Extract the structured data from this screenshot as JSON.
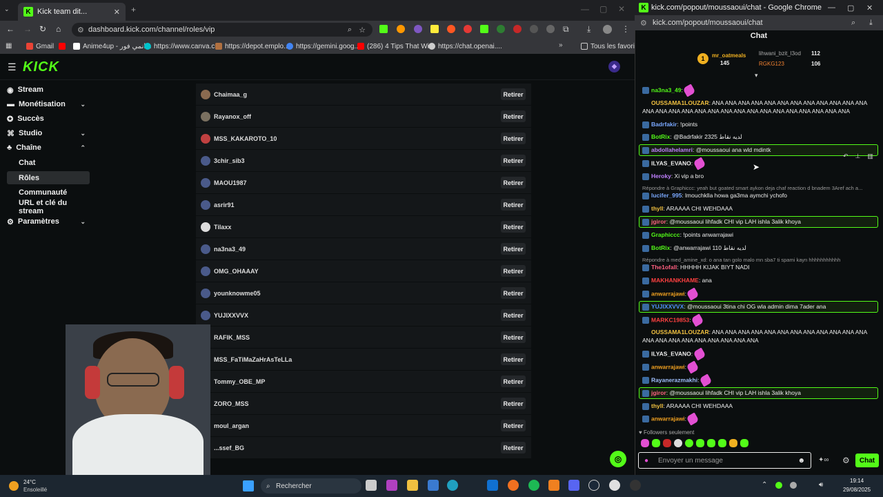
{
  "main_browser": {
    "tab_title": "Kick team dit...",
    "url": "dashboard.kick.com/channel/roles/vip",
    "bookmarks": [
      "Gmail",
      "Anime4up - انمي فور...",
      "https://www.canva.c...",
      "https://depot.emplo...",
      "https://gemini.goog...",
      "(286) 4 Tips That Wi...",
      "https://chat.openai...."
    ],
    "all_bookmarks": "Tous les favoris"
  },
  "dashboard": {
    "logo": "KICK",
    "sidebar": [
      {
        "label": "Stream",
        "icon": "broadcast-icon"
      },
      {
        "label": "Monétisation",
        "icon": "money-icon"
      },
      {
        "label": "Succès",
        "icon": "trophy-icon"
      },
      {
        "label": "Studio",
        "icon": "studio-icon"
      },
      {
        "label": "Chaîne",
        "icon": "channel-icon"
      },
      {
        "label": "Chat"
      },
      {
        "label": "Rôles"
      },
      {
        "label": "Communauté"
      },
      {
        "label": "URL et clé du stream"
      },
      {
        "label": "Paramètres",
        "icon": "gear-icon"
      }
    ],
    "remove_label": "Retirer",
    "vips": [
      "Chaimaa_g",
      "Rayanox_off",
      "MSS_KAKAROTO_10",
      "3chir_sib3",
      "MAOU1987",
      "asrir91",
      "Tilaxx",
      "na3na3_49",
      "OMG_OHAAAY",
      "younknowme05",
      "YUJIXXVVX",
      "RAFIK_MSS",
      "MSS_FaTiMaZaHrAsTeLLa",
      "Tommy_OBE_MP",
      "ZORO_MSS",
      "moul_argan",
      "...ssef_BG"
    ]
  },
  "chat_window": {
    "title": "kick.com/popout/moussaoui/chat - Google Chrome",
    "url": "kick.com/popout/moussaoui/chat",
    "header": "Chat",
    "leaderboard": [
      {
        "rank": "1",
        "name": "mr_oatmeals",
        "count": "145"
      },
      {
        "name": "lihwani_bzit_l3od",
        "count": "112"
      },
      {
        "name": "RGKG123",
        "count": "106"
      }
    ],
    "messages": [
      {
        "user": "na3na3_49",
        "text": ": ",
        "color": "#53fc18"
      },
      {
        "user": "OUSSAMA1LOUZAR",
        "text": ": ANA ANA ANA ANA ANA ANA ANA ANA ANA ANA ANA ANA ANA ANA ANA ANA ANA ANA ANA ANA ANA ANA ANA ANA ANA ANA ANA ANA",
        "color": "#f0c040"
      },
      {
        "user": "Badrfakir",
        "text": ": !points",
        "color": "#7aa8ff"
      },
      {
        "user": "BotRix",
        "text": ": @Badrfakir 2325 لديه نقاط",
        "color": "#53fc18"
      },
      {
        "user": "abdollahelamri",
        "text": ": @moussaoui ana wld mdintk",
        "color": "#c080ff"
      },
      {
        "user": "ILYAS_EVANO",
        "text": ": ",
        "color": "#eee"
      },
      {
        "user": "Heroky",
        "text": ": Xi vip a bro",
        "color": "#c080ff"
      },
      {
        "user": "lucifer_995",
        "text": ": lmouchklla howa ga3ma aymchi ychofo",
        "color": "#7aa8ff"
      },
      {
        "user": "thyll",
        "text": ": ARAAAA CHI WEHDAAA",
        "color": "#f0c040"
      },
      {
        "user": "jgiror",
        "text": ": @moussaoui lihfadk CHI vip LAH ishla 3alik khoya",
        "color": "#ff6080"
      },
      {
        "user": "Graphiccc",
        "text": ": !points anwarrajawi",
        "color": "#53fc18"
      },
      {
        "user": "BotRix",
        "text": ": @anwarrajawi 110 لديه نقاط",
        "color": "#53fc18"
      },
      {
        "user": "The1ofall",
        "text": ": HHHHH KIJAK BIYT NADI",
        "color": "#ff6080"
      },
      {
        "user": "MAKHANKHAME",
        "text": ": ana",
        "color": "#ff4040"
      },
      {
        "user": "anwarrajawi",
        "text": ": ",
        "color": "#f0a020"
      },
      {
        "user": "YUJIXXVVX",
        "text": ": @moussaoui 3tina chi OG wla admin dima 7ader ana",
        "color": "#5090ff"
      },
      {
        "user": "MARKC19853",
        "text": ": ",
        "color": "#ff4040"
      },
      {
        "user": "OUSSAMA1LOUZAR",
        "text": ": ANA ANA ANA ANA ANA ANA ANA ANA ANA ANA ANA ANA ANA ANA ANA ANA ANA ANA ANA ANA ANA",
        "color": "#f0c040"
      },
      {
        "user": "ILYAS_EVANO",
        "text": ": ",
        "color": "#eee"
      },
      {
        "user": "anwarrajawi",
        "text": ": ",
        "color": "#f0a020"
      },
      {
        "user": "Rayanerazmakhi",
        "text": ": ",
        "color": "#a0c0ff"
      },
      {
        "user": "jgiror",
        "text": ": @moussaoui lihfadk CHI vip LAH ishla 3alik khoya",
        "color": "#ff6080"
      },
      {
        "user": "thyll",
        "text": ": ARAAAA CHI WEHDAAA",
        "color": "#f0c040"
      },
      {
        "user": "anwarrajawi",
        "text": ": ",
        "color": "#f0a020"
      }
    ],
    "reply1": "Répondre à Graphiccc: yeah but goated smart aykon deja chaf reaction d bnadem 3Aref ach a...",
    "reply2": "Répondre à med_amine_xd: o ana tan golo malo mn sba7 ti spami kayn hhhhhhhhhhh",
    "followers_only": "Followers seulement",
    "input_placeholder": "Envoyer un message",
    "send_label": "Chat"
  },
  "taskbar": {
    "weather_temp": "24°C",
    "weather_desc": "Ensoleillé",
    "search_placeholder": "Rechercher",
    "time": "19:14",
    "date": "29/08/2025"
  }
}
